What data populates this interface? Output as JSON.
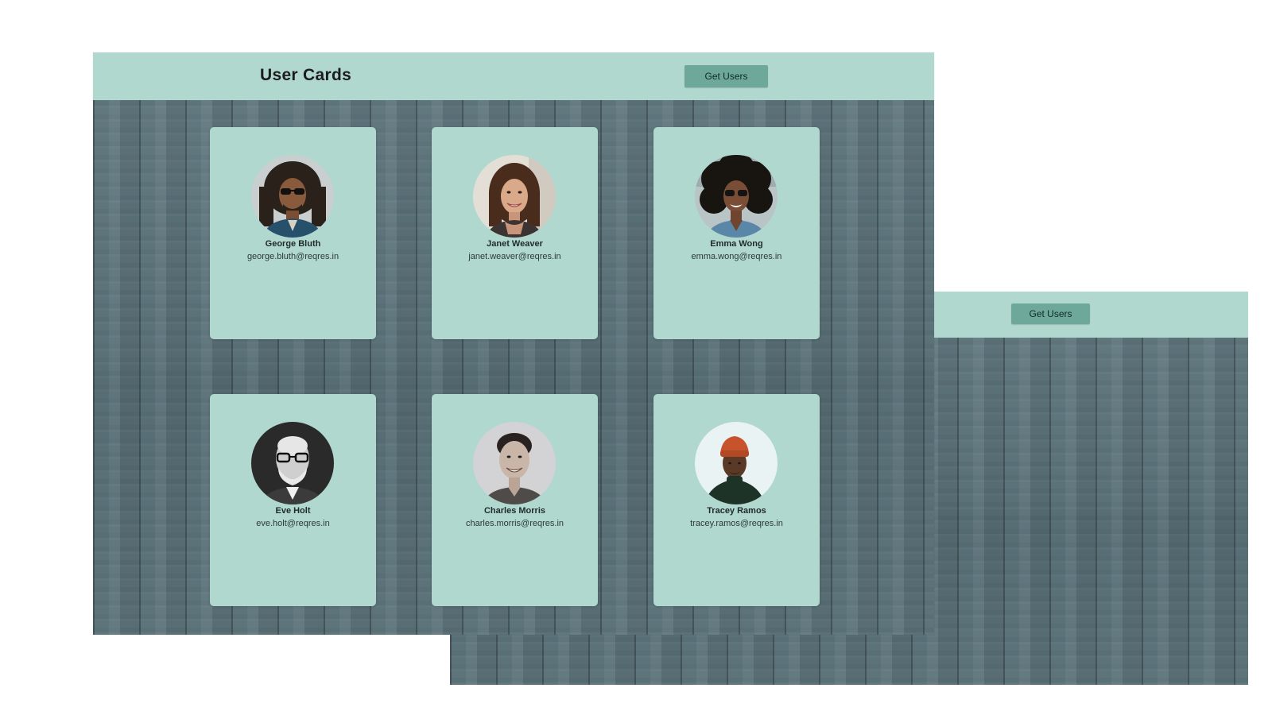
{
  "back_window": {
    "get_users_label": "Get Users"
  },
  "front_window": {
    "title": "User Cards",
    "get_users_label": "Get Users"
  },
  "users": [
    {
      "name": "George Bluth",
      "email": "george.bluth@reqres.in",
      "avatar_icon": "avatar-photo-icon"
    },
    {
      "name": "Janet Weaver",
      "email": "janet.weaver@reqres.in",
      "avatar_icon": "avatar-photo-icon"
    },
    {
      "name": "Emma Wong",
      "email": "emma.wong@reqres.in",
      "avatar_icon": "avatar-photo-icon"
    },
    {
      "name": "Eve Holt",
      "email": "eve.holt@reqres.in",
      "avatar_icon": "avatar-photo-icon"
    },
    {
      "name": "Charles Morris",
      "email": "charles.morris@reqres.in",
      "avatar_icon": "avatar-photo-icon"
    },
    {
      "name": "Tracey Ramos",
      "email": "tracey.ramos@reqres.in",
      "avatar_icon": "avatar-photo-icon"
    }
  ],
  "colors": {
    "header_bg": "#b0d8cf",
    "card_bg": "#b0d8cf",
    "button_bg": "#6ea89b",
    "background_wood": "#5d747b"
  }
}
